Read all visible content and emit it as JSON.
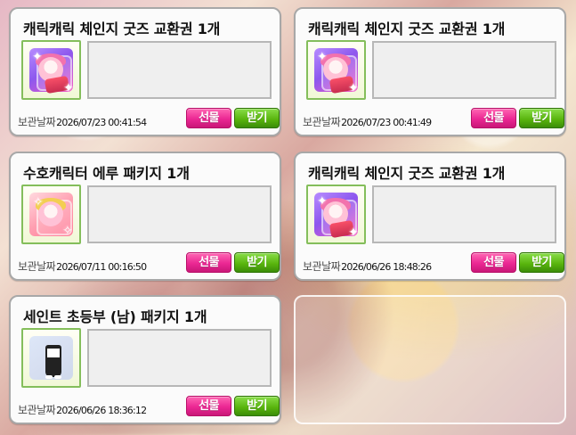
{
  "labels": {
    "date": "보관날짜",
    "gift": "선물",
    "receive": "받기"
  },
  "cards": [
    {
      "title": "캐릭캐릭 체인지 굿즈 교환권 1개",
      "date": "2026/07/23 00:41:54",
      "icon": "character-card-icon"
    },
    {
      "title": "캐릭캐릭 체인지 굿즈 교환권 1개",
      "date": "2026/07/23 00:41:49",
      "icon": "character-card-icon"
    },
    {
      "title": "수호캐릭터 에루 패키지 1개",
      "date": "2026/07/11 00:16:50",
      "icon": "guardian-character-package-icon"
    },
    {
      "title": "캐릭캐릭 체인지 굿즈 교환권 1개",
      "date": "2026/06/26 18:48:26",
      "icon": "character-card-icon"
    },
    {
      "title": "세인트 초등부 (남) 패키지 1개",
      "date": "2026/06/26 18:36:12",
      "icon": "school-uniform-package-icon"
    }
  ]
}
